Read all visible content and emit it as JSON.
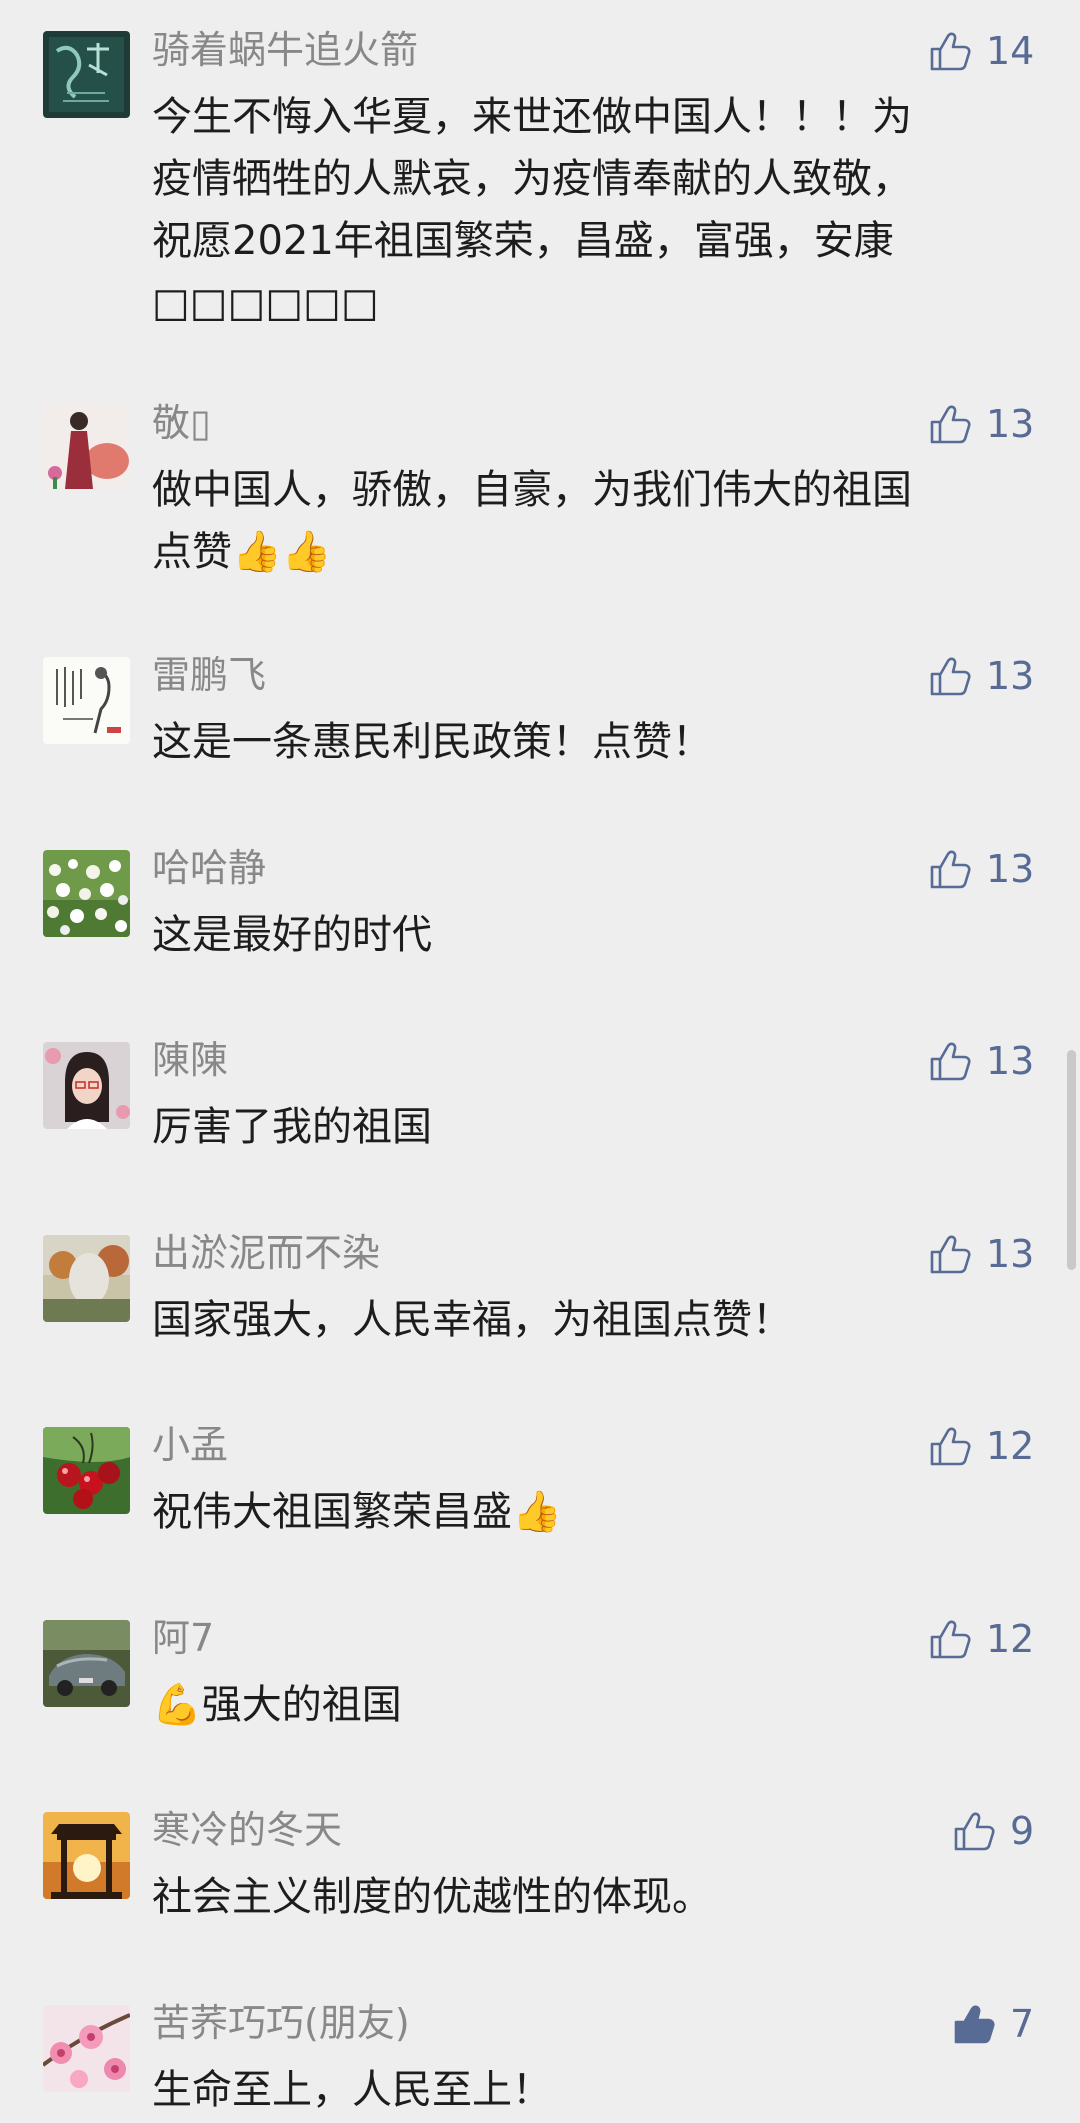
{
  "comments": [
    {
      "nickname": "骑着蜗牛追火箭",
      "text": "今生不悔入华夏，来世还做中国人！！！为\n疫情牺牲的人默哀，为疫情奉献的人致敬，\n祝愿2021年祖国繁荣，昌盛，富强，安康\n□□□□□□",
      "likes": "14"
    },
    {
      "nickname": "敬▯",
      "text": "做中国人，骄傲，自豪，为我们伟大的祖国\n点赞👍👍",
      "likes": "13"
    },
    {
      "nickname": "雷鹏飞",
      "text": "这是一条惠民利民政策！点赞！",
      "likes": "13"
    },
    {
      "nickname": "哈哈静",
      "text": "这是最好的时代",
      "likes": "13"
    },
    {
      "nickname": "陳陳",
      "text": "厉害了我的祖国",
      "likes": "13"
    },
    {
      "nickname": "出淤泥而不染",
      "text": "国家强大，人民幸福，为祖国点赞！",
      "likes": "13"
    },
    {
      "nickname": "小孟",
      "text": "祝伟大祖国繁荣昌盛👍",
      "likes": "12"
    },
    {
      "nickname": "阿7",
      "text": "💪强大的祖国",
      "likes": "12"
    },
    {
      "nickname": "寒冷的冬天",
      "text": "社会主义制度的优越性的体现。",
      "likes": "9"
    },
    {
      "nickname": "苦荞巧巧(朋友)",
      "text": "生命至上，人民至上！",
      "likes": "7",
      "liked": true
    }
  ],
  "colors": {
    "background": "#eeeeee",
    "nickname": "#888888",
    "text": "#1d1d1d",
    "like_accent": "#576b95"
  },
  "icons": {
    "like": "thumbs-up-icon",
    "like_active": "thumbs-up-filled-icon"
  }
}
